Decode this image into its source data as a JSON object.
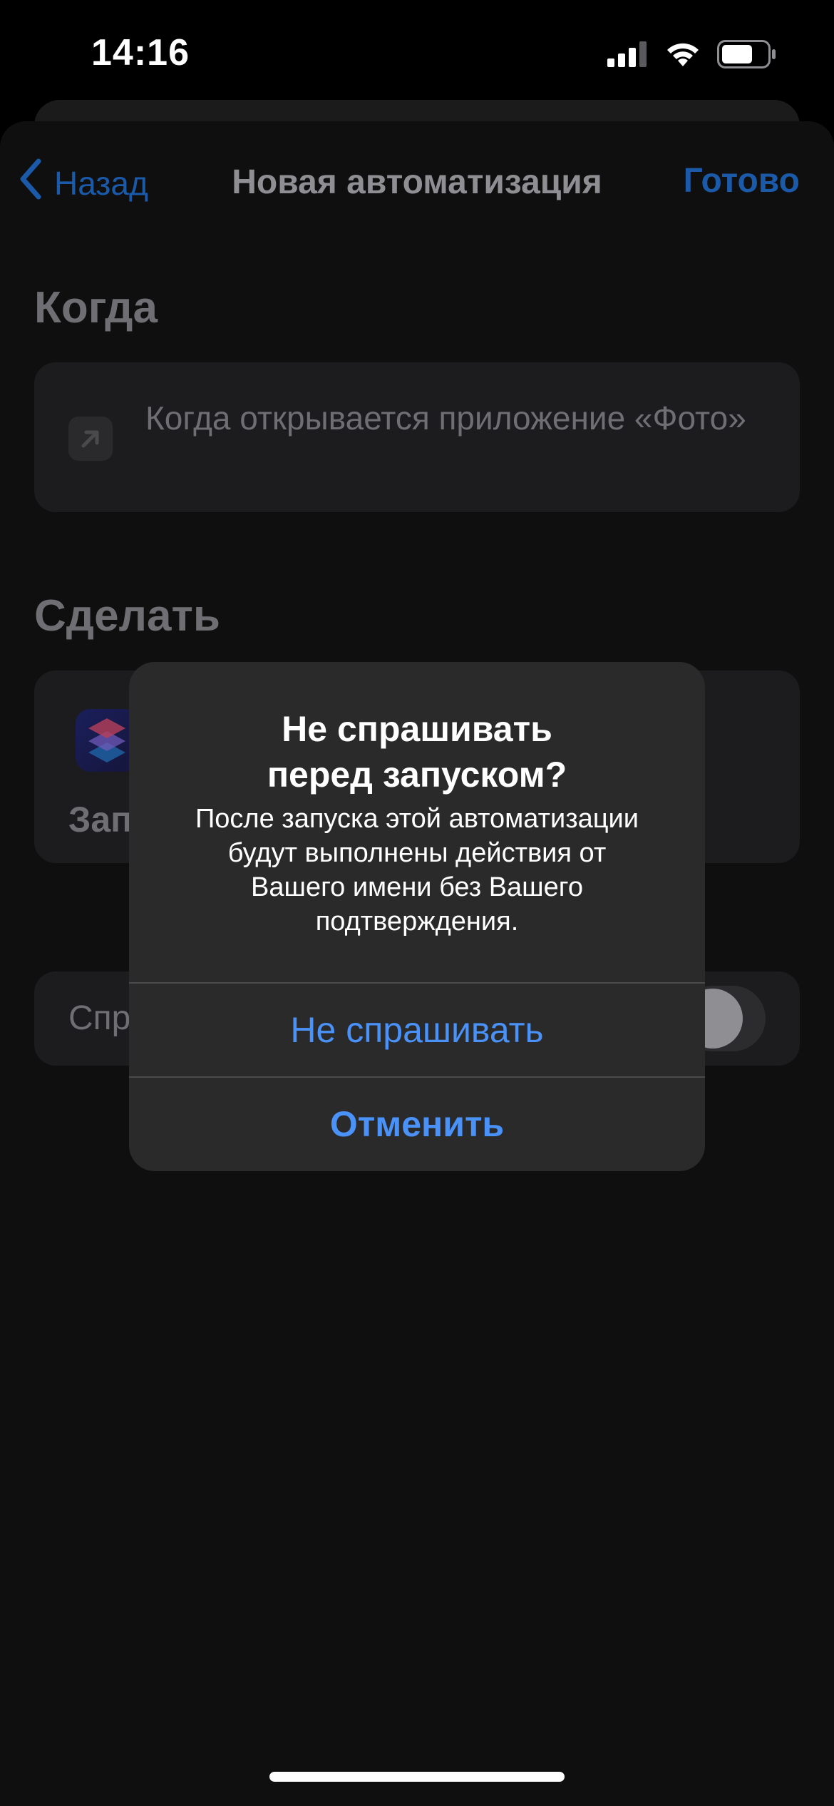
{
  "status_bar": {
    "time": "14:16",
    "signal_icon": "cellular-signal-icon",
    "wifi_icon": "wifi-icon",
    "battery_icon": "battery-icon"
  },
  "nav": {
    "back_label": "Назад",
    "title": "Новая автоматизация",
    "done_label": "Готово"
  },
  "when": {
    "section_title": "Когда",
    "trigger_text": "Когда открывается приложение «Фото»",
    "trigger_icon": "open-app-arrow-icon"
  },
  "do": {
    "section_title": "Сделать",
    "action_label_partial": "Зап",
    "action_icon": "shortcuts-app-icon"
  },
  "ask": {
    "label_partial": "Спр",
    "toggle_on": false
  },
  "alert": {
    "title": "Не спрашивать перед запуском?",
    "title_line1": "Не спрашивать",
    "title_line2": "перед запуском?",
    "message": "После запуска этой автоматизации будут выполнены действия от Вашего имени без Вашего подтверждения.",
    "message_line1": "После запуска этой автоматизации",
    "message_line2": "будут выполнены действия от",
    "message_line3": "Вашего имени без Вашего",
    "message_line4": "подтверждения.",
    "confirm_label": "Не спрашивать",
    "cancel_label": "Отменить"
  },
  "colors": {
    "accent_dimmed": "#1b5aa8",
    "alert_button": "#4a92f7",
    "background": "#000000"
  }
}
